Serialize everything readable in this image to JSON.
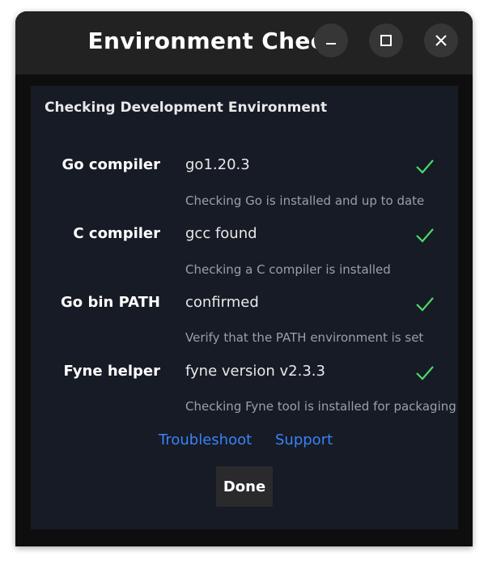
{
  "window": {
    "title": "Environment Check",
    "controls": {
      "minimize_icon": "minimize-icon",
      "maximize_icon": "maximize-icon",
      "close_icon": "close-icon"
    }
  },
  "content": {
    "heading": "Checking Development Environment",
    "rows": [
      {
        "label": "Go compiler",
        "value": "go1.20.3",
        "description": "Checking Go is installed and up to date",
        "status": "ok"
      },
      {
        "label": "C compiler",
        "value": "gcc found",
        "description": "Checking a C compiler is installed",
        "status": "ok"
      },
      {
        "label": "Go bin PATH",
        "value": "confirmed",
        "description": "Verify that the PATH environment is set",
        "status": "ok"
      },
      {
        "label": "Fyne helper",
        "value": "fyne version v2.3.3",
        "description": "Checking Fyne tool is installed for packaging",
        "status": "ok"
      }
    ],
    "links": {
      "troubleshoot": "Troubleshoot",
      "support": "Support"
    },
    "done_label": "Done"
  },
  "colors": {
    "check": "#4cd964",
    "link": "#3b82f6",
    "panel": "#161b25"
  }
}
